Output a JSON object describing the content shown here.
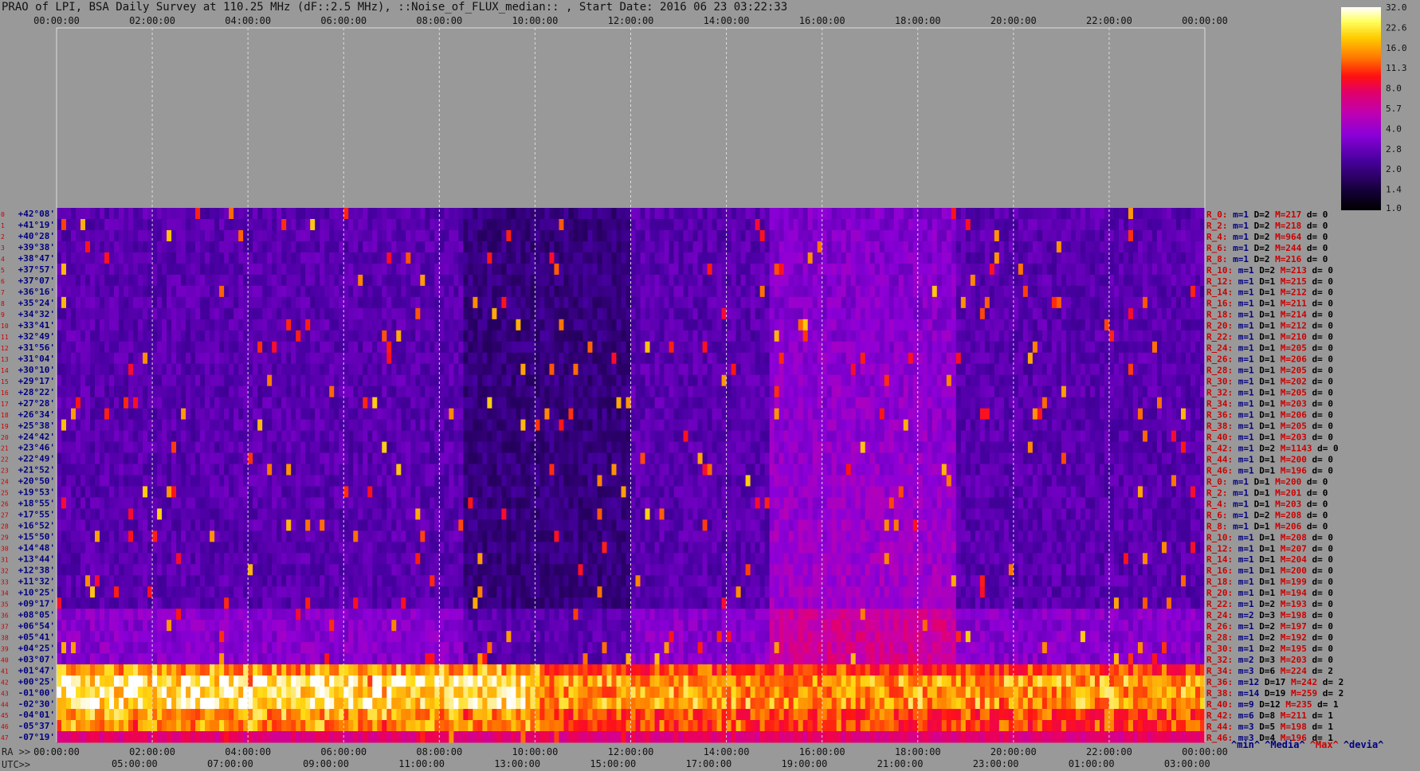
{
  "title": "PRAO of LPI, BSA Daily Survey at 110.25 MHz (dF::2.5 MHz), ::Noise_of_FLUX_median:: , Start Date: 2016 06 23 03:22:33",
  "colors": {
    "background": "#999999",
    "grid": "#dddddd",
    "red_label": "#cc0000",
    "blue_label": "#000080"
  },
  "chart_data": {
    "type": "heatmap",
    "x_top_ticks": [
      "00:00:00",
      "02:00:00",
      "04:00:00",
      "06:00:00",
      "08:00:00",
      "10:00:00",
      "12:00:00",
      "14:00:00",
      "16:00:00",
      "18:00:00",
      "20:00:00",
      "22:00:00",
      "00:00:00"
    ],
    "ra_prefix": "RA >>",
    "ra_ticks": [
      "00:00:00",
      "02:00:00",
      "04:00:00",
      "06:00:00",
      "08:00:00",
      "10:00:00",
      "12:00:00",
      "14:00:00",
      "16:00:00",
      "18:00:00",
      "20:00:00",
      "22:00:00",
      "00:00:00"
    ],
    "utc_prefix": "UTC>>",
    "utc_ticks": [
      "05:00:00",
      "07:00:00",
      "09:00:00",
      "11:00:00",
      "13:00:00",
      "15:00:00",
      "17:00:00",
      "19:00:00",
      "21:00:00",
      "23:00:00",
      "01:00:00",
      "03:00:00"
    ],
    "dec_ticks": [
      "+42°08'",
      "+41°19'",
      "+40°28'",
      "+39°38'",
      "+38°47'",
      "+37°57'",
      "+37°07'",
      "+36°16'",
      "+35°24'",
      "+34°32'",
      "+33°41'",
      "+32°49'",
      "+31°56'",
      "+31°04'",
      "+30°10'",
      "+29°17'",
      "+28°22'",
      "+27°28'",
      "+26°34'",
      "+25°38'",
      "+24°42'",
      "+23°46'",
      "+22°49'",
      "+21°52'",
      "+20°50'",
      "+19°53'",
      "+18°55'",
      "+17°55'",
      "+16°52'",
      "+15°50'",
      "+14°48'",
      "+13°44'",
      "+12°38'",
      "+11°32'",
      "+10°25'",
      "+09°17'",
      "+08°05'",
      "+06°54'",
      "+05°41'",
      "+04°25'",
      "+03°07'",
      "+01°47'",
      "+00°25'",
      "-01°00'",
      "-02°30'",
      "-04°01'",
      "-05°37'",
      "-07°19'"
    ],
    "beam_numbers": [
      "0",
      "1",
      "2",
      "3",
      "4",
      "5",
      "6",
      "7",
      "8",
      "9",
      "10",
      "11",
      "12",
      "13",
      "14",
      "15",
      "16",
      "17",
      "18",
      "19",
      "20",
      "21",
      "22",
      "23",
      "24",
      "25",
      "26",
      "27",
      "28",
      "29",
      "30",
      "31",
      "32",
      "33",
      "34",
      "35",
      "36",
      "37",
      "38",
      "39",
      "40",
      "41",
      "42",
      "43",
      "44",
      "45",
      "46",
      "47"
    ],
    "right_stats": [
      {
        "r": "R_0:",
        "m": "m=1",
        "d": "D=2",
        "M": "M=217",
        "dev": "d= 0"
      },
      {
        "r": "R_2:",
        "m": "m=1",
        "d": "D=2",
        "M": "M=218",
        "dev": "d= 0"
      },
      {
        "r": "R_4:",
        "m": "m=1",
        "d": "D=2",
        "M": "M=964",
        "dev": "d= 0"
      },
      {
        "r": "R_6:",
        "m": "m=1",
        "d": "D=2",
        "M": "M=244",
        "dev": "d= 0"
      },
      {
        "r": "R_8:",
        "m": "m=1",
        "d": "D=2",
        "M": "M=216",
        "dev": "d= 0"
      },
      {
        "r": "R_10:",
        "m": "m=1",
        "d": "D=2",
        "M": "M=213",
        "dev": "d= 0"
      },
      {
        "r": "R_12:",
        "m": "m=1",
        "d": "D=1",
        "M": "M=215",
        "dev": "d= 0"
      },
      {
        "r": "R_14:",
        "m": "m=1",
        "d": "D=1",
        "M": "M=212",
        "dev": "d= 0"
      },
      {
        "r": "R_16:",
        "m": "m=1",
        "d": "D=1",
        "M": "M=211",
        "dev": "d= 0"
      },
      {
        "r": "R_18:",
        "m": "m=1",
        "d": "D=1",
        "M": "M=214",
        "dev": "d= 0"
      },
      {
        "r": "R_20:",
        "m": "m=1",
        "d": "D=1",
        "M": "M=212",
        "dev": "d= 0"
      },
      {
        "r": "R_22:",
        "m": "m=1",
        "d": "D=1",
        "M": "M=210",
        "dev": "d= 0"
      },
      {
        "r": "R_24:",
        "m": "m=1",
        "d": "D=1",
        "M": "M=205",
        "dev": "d= 0"
      },
      {
        "r": "R_26:",
        "m": "m=1",
        "d": "D=1",
        "M": "M=206",
        "dev": "d= 0"
      },
      {
        "r": "R_28:",
        "m": "m=1",
        "d": "D=1",
        "M": "M=205",
        "dev": "d= 0"
      },
      {
        "r": "R_30:",
        "m": "m=1",
        "d": "D=1",
        "M": "M=202",
        "dev": "d= 0"
      },
      {
        "r": "R_32:",
        "m": "m=1",
        "d": "D=1",
        "M": "M=205",
        "dev": "d= 0"
      },
      {
        "r": "R_34:",
        "m": "m=1",
        "d": "D=1",
        "M": "M=203",
        "dev": "d= 0"
      },
      {
        "r": "R_36:",
        "m": "m=1",
        "d": "D=1",
        "M": "M=206",
        "dev": "d= 0"
      },
      {
        "r": "R_38:",
        "m": "m=1",
        "d": "D=1",
        "M": "M=205",
        "dev": "d= 0"
      },
      {
        "r": "R_40:",
        "m": "m=1",
        "d": "D=1",
        "M": "M=203",
        "dev": "d= 0"
      },
      {
        "r": "R_42:",
        "m": "m=1",
        "d": "D=2",
        "M": "M=1143",
        "dev": "d= 0"
      },
      {
        "r": "R_44:",
        "m": "m=1",
        "d": "D=1",
        "M": "M=200",
        "dev": "d= 0"
      },
      {
        "r": "R_46:",
        "m": "m=1",
        "d": "D=1",
        "M": "M=196",
        "dev": "d= 0"
      },
      {
        "r": "R_0:",
        "m": "m=1",
        "d": "D=1",
        "M": "M=200",
        "dev": "d= 0"
      },
      {
        "r": "R_2:",
        "m": "m=1",
        "d": "D=1",
        "M": "M=201",
        "dev": "d= 0"
      },
      {
        "r": "R_4:",
        "m": "m=1",
        "d": "D=1",
        "M": "M=203",
        "dev": "d= 0"
      },
      {
        "r": "R_6:",
        "m": "m=1",
        "d": "D=2",
        "M": "M=208",
        "dev": "d= 0"
      },
      {
        "r": "R_8:",
        "m": "m=1",
        "d": "D=1",
        "M": "M=206",
        "dev": "d= 0"
      },
      {
        "r": "R_10:",
        "m": "m=1",
        "d": "D=1",
        "M": "M=208",
        "dev": "d= 0"
      },
      {
        "r": "R_12:",
        "m": "m=1",
        "d": "D=1",
        "M": "M=207",
        "dev": "d= 0"
      },
      {
        "r": "R_14:",
        "m": "m=1",
        "d": "D=1",
        "M": "M=204",
        "dev": "d= 0"
      },
      {
        "r": "R_16:",
        "m": "m=1",
        "d": "D=1",
        "M": "M=200",
        "dev": "d= 0"
      },
      {
        "r": "R_18:",
        "m": "m=1",
        "d": "D=1",
        "M": "M=199",
        "dev": "d= 0"
      },
      {
        "r": "R_20:",
        "m": "m=1",
        "d": "D=1",
        "M": "M=194",
        "dev": "d= 0"
      },
      {
        "r": "R_22:",
        "m": "m=1",
        "d": "D=2",
        "M": "M=193",
        "dev": "d= 0"
      },
      {
        "r": "R_24:",
        "m": "m=2",
        "d": "D=3",
        "M": "M=198",
        "dev": "d= 0"
      },
      {
        "r": "R_26:",
        "m": "m=1",
        "d": "D=2",
        "M": "M=197",
        "dev": "d= 0"
      },
      {
        "r": "R_28:",
        "m": "m=1",
        "d": "D=2",
        "M": "M=192",
        "dev": "d= 0"
      },
      {
        "r": "R_30:",
        "m": "m=1",
        "d": "D=2",
        "M": "M=195",
        "dev": "d= 0"
      },
      {
        "r": "R_32:",
        "m": "m=2",
        "d": "D=3",
        "M": "M=203",
        "dev": "d= 0"
      },
      {
        "r": "R_34:",
        "m": "m=3",
        "d": "D=6",
        "M": "M=224",
        "dev": "d= 2"
      },
      {
        "r": "R_36:",
        "m": "m=12",
        "d": "D=17",
        "M": "M=242",
        "dev": "d= 2"
      },
      {
        "r": "R_38:",
        "m": "m=14",
        "d": "D=19",
        "M": "M=259",
        "dev": "d= 2"
      },
      {
        "r": "R_40:",
        "m": "m=9",
        "d": "D=12",
        "M": "M=235",
        "dev": "d= 1"
      },
      {
        "r": "R_42:",
        "m": "m=6",
        "d": "D=8",
        "M": "M=211",
        "dev": "d= 1"
      },
      {
        "r": "R_44:",
        "m": "m=3",
        "d": "D=5",
        "M": "M=198",
        "dev": "d= 1"
      },
      {
        "r": "R_46:",
        "m": "m=3",
        "d": "D=4",
        "M": "M=196",
        "dev": "d= 1"
      }
    ],
    "colorbar_ticks": [
      "32.0",
      "22.6",
      "16.0",
      "11.3",
      "8.0",
      "5.7",
      "4.0",
      "2.8",
      "2.0",
      "1.4",
      "1.0"
    ],
    "footer_legend": [
      {
        "text": "^min^",
        "color": "#000080"
      },
      {
        "text": "^Media^",
        "color": "#000080"
      },
      {
        "text": "^Max^",
        "color": "#cc0000"
      },
      {
        "text": "^devia^",
        "color": "#000080"
      }
    ]
  }
}
